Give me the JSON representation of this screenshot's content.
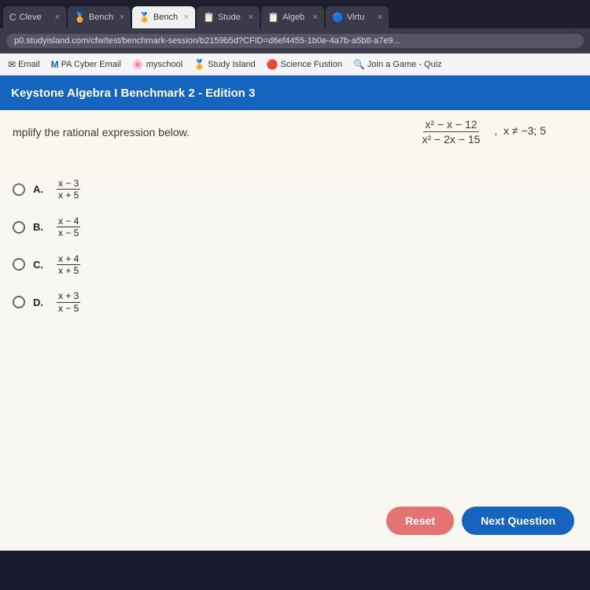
{
  "browser": {
    "tabs": [
      {
        "id": "cleve",
        "label": "Cleve",
        "icon": "C",
        "active": false,
        "closable": true
      },
      {
        "id": "bench1",
        "label": "Bench",
        "icon": "🏅",
        "active": false,
        "closable": true
      },
      {
        "id": "bench2",
        "label": "Bench",
        "icon": "🏅",
        "active": true,
        "closable": true
      },
      {
        "id": "stude",
        "label": "Stude",
        "icon": "📋",
        "active": false,
        "closable": true
      },
      {
        "id": "algeb",
        "label": "Algeb",
        "icon": "📋",
        "active": false,
        "closable": true
      },
      {
        "id": "virtu",
        "label": "Virtu",
        "icon": "🔵",
        "active": false,
        "closable": true
      }
    ],
    "address_url": "p0.studyisland.com/cfw/test/benchmark-session/b2159b5d?CFID=d6ef4455-1b0e-4a7b-a5b8-a7e9..."
  },
  "bookmarks": [
    {
      "label": "Email",
      "icon": "✉"
    },
    {
      "label": "PA Cyber Email",
      "icon": "M"
    },
    {
      "label": "myschool",
      "icon": "🌸"
    },
    {
      "label": "Study Island",
      "icon": "🏅"
    },
    {
      "label": "Science Fustion",
      "icon": "🔴"
    },
    {
      "label": "Join a Game - Quiz",
      "icon": "🔍"
    }
  ],
  "page": {
    "header": "Keystone Algebra I Benchmark 2 - Edition 3",
    "question": {
      "instruction": "mplify the rational expression below.",
      "expression_numerator": "x² − x − 12",
      "expression_denominator": "x² − 2x − 15",
      "condition": "x ≠ −3; 5"
    },
    "options": [
      {
        "id": "A",
        "numerator": "x − 3",
        "denominator": "x + 5"
      },
      {
        "id": "B",
        "numerator": "x − 4",
        "denominator": "x − 5"
      },
      {
        "id": "C",
        "numerator": "x + 4",
        "denominator": "x + 5"
      },
      {
        "id": "D",
        "numerator": "x + 3",
        "denominator": "x − 5"
      }
    ],
    "buttons": {
      "reset": "Reset",
      "next": "Next Question"
    }
  }
}
